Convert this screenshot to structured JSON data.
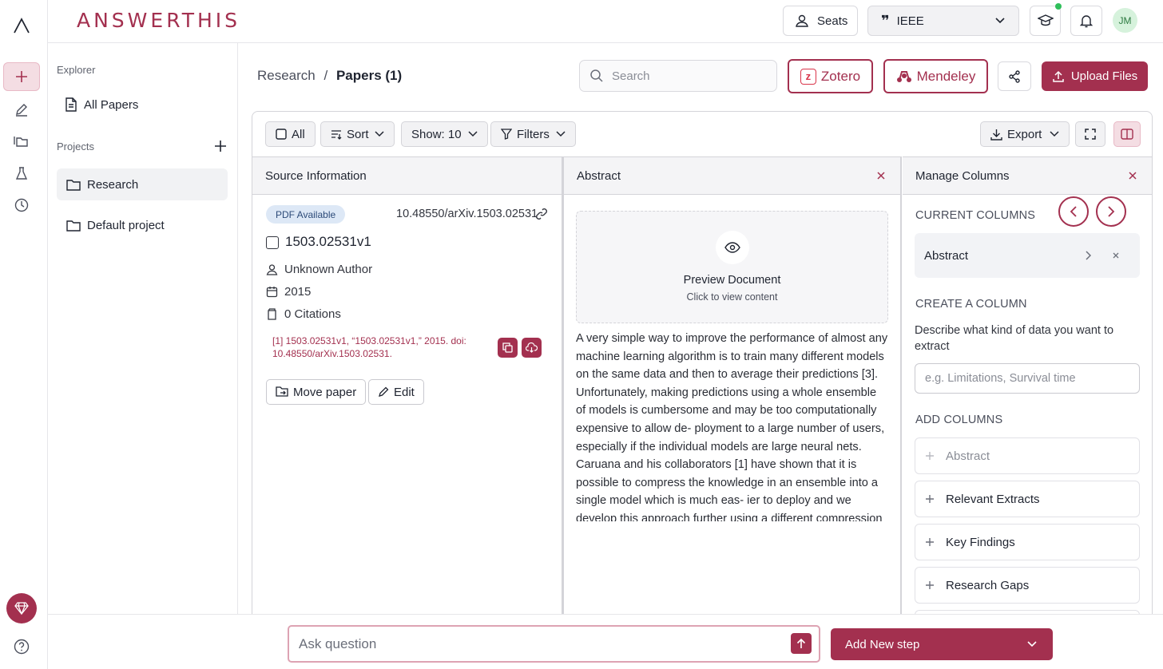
{
  "app": {
    "logo": "ANSWERTHIS"
  },
  "topbar": {
    "seats_label": "Seats",
    "citation_style": "IEEE",
    "avatar_initials": "JM"
  },
  "sidebar": {
    "explorer_label": "Explorer",
    "all_papers_label": "All Papers",
    "projects_label": "Projects",
    "projects": [
      {
        "label": "Research"
      },
      {
        "label": "Default project"
      }
    ]
  },
  "header": {
    "breadcrumb_root": "Research",
    "breadcrumb_sep": "/",
    "breadcrumb_current": "Papers (1)",
    "search_placeholder": "Search",
    "zotero_label": "Zotero",
    "mendeley_label": "Mendeley",
    "upload_label": "Upload Files"
  },
  "toolbar": {
    "all_label": "All",
    "sort_label": "Sort",
    "show_label": "Show: 10",
    "filters_label": "Filters",
    "export_label": "Export"
  },
  "columns": {
    "source_title": "Source Information",
    "abstract_title": "Abstract",
    "manage_title": "Manage Columns"
  },
  "paper": {
    "badge": "PDF Available",
    "doi": "10.48550/arXiv.1503.02531",
    "title": "1503.02531v1",
    "author": "Unknown Author",
    "year": "2015",
    "citations": "0 Citations",
    "citation_text": "[1] 1503.02531v1, “1503.02531v1,” 2015. doi: 10.48550/arXiv.1503.02531.",
    "move_label": "Move paper",
    "edit_label": "Edit"
  },
  "abstract": {
    "preview_title": "Preview Document",
    "preview_sub": "Click to view content",
    "text": "A very simple way to improve the performance of almost any machine learning algorithm is to train many different models on the same data and then to average their predictions [3]. Unfortunately, making predictions using a whole ensemble of models is cumbersome and may be too computationally expensive to allow de- ployment to a large number of users, especially if the individual models are large neural nets. Caruana and his collaborators [1] have shown that it is possible to compress the knowledge in an ensemble into a single model which is much eas- ier to deploy and we develop this approach further using a different compression"
  },
  "manage": {
    "current_label": "CURRENT COLUMNS",
    "current_columns": [
      "Abstract"
    ],
    "create_label": "CREATE A COLUMN",
    "create_desc": "Describe what kind of data you want to extract",
    "create_placeholder": "e.g. Limitations, Survival time",
    "add_label": "ADD COLUMNS",
    "add_columns": [
      "Abstract",
      "Relevant Extracts",
      "Key Findings",
      "Research Gaps"
    ]
  },
  "bottom": {
    "ask_placeholder": "Ask question",
    "step_label": "Add New step"
  },
  "colors": {
    "accent": "#a3304f",
    "badge_bg": "#dde8f6",
    "online": "#2fbf5a"
  }
}
